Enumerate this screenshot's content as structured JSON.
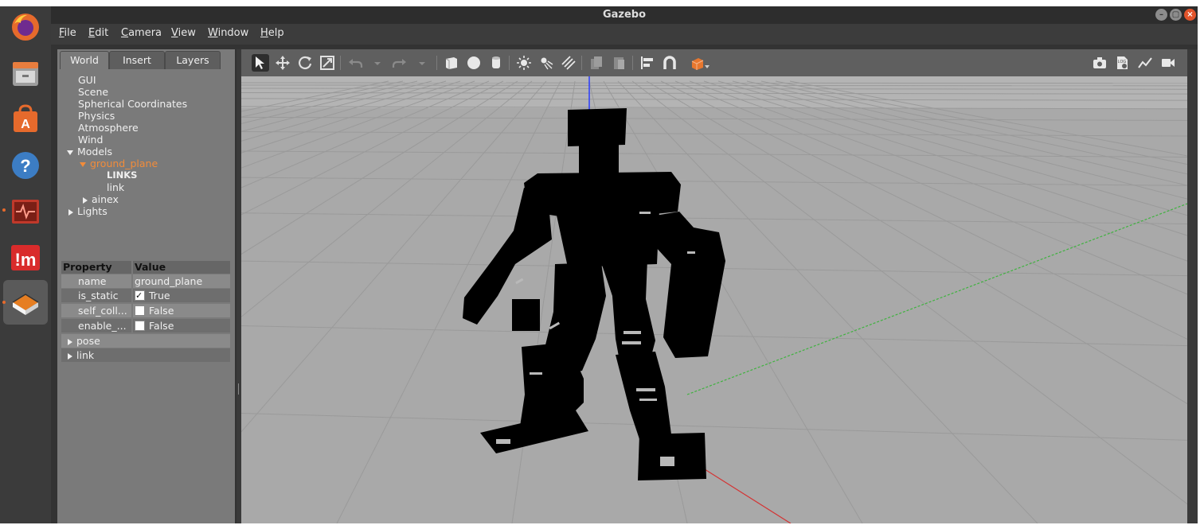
{
  "window": {
    "title": "Gazebo",
    "controls": {
      "minimize": "–",
      "maximize": "▢",
      "close": "×"
    }
  },
  "menu": [
    "File",
    "Edit",
    "Camera",
    "View",
    "Window",
    "Help"
  ],
  "left_panel": {
    "tabs": [
      "World",
      "Insert",
      "Layers"
    ],
    "active_tab": "World",
    "tree": {
      "gui": "GUI",
      "scene": "Scene",
      "spherical": "Spherical Coordinates",
      "physics": "Physics",
      "atmosphere": "Atmosphere",
      "wind": "Wind",
      "models": "Models",
      "ground_plane": "ground_plane",
      "links_header": "LINKS",
      "link": "link",
      "ainex": "ainex",
      "lights": "Lights"
    },
    "properties": {
      "header_property": "Property",
      "header_value": "Value",
      "rows": [
        {
          "name": "name",
          "value": "ground_plane"
        },
        {
          "name": "is_static",
          "value": "True",
          "checked": true
        },
        {
          "name": "self_coll...",
          "value": "False",
          "checked": false
        },
        {
          "name": "enable_...",
          "value": "False",
          "checked": false
        }
      ],
      "pose": "pose",
      "link": "link"
    }
  },
  "toolbar": {
    "icons": [
      "select-mode-icon",
      "translate-icon",
      "rotate-icon",
      "scale-icon",
      "undo-icon",
      "undo-history-icon",
      "redo-icon",
      "redo-history-icon",
      "box-icon",
      "sphere-icon",
      "cylinder-icon",
      "point-light-icon",
      "spot-light-icon",
      "directional-light-icon",
      "copy-icon",
      "paste-icon",
      "align-icon",
      "snap-icon",
      "view-angle-icon"
    ],
    "right_icons": [
      "screenshot-icon",
      "log-icon",
      "plot-icon",
      "record-video-icon"
    ],
    "log_label": "LOG"
  },
  "colors": {
    "accent": "#f28c3a",
    "viewport_bg": "#a9a9a9",
    "panel_bg": "#7a7a7a",
    "dock_bg": "#3b3b3b"
  }
}
